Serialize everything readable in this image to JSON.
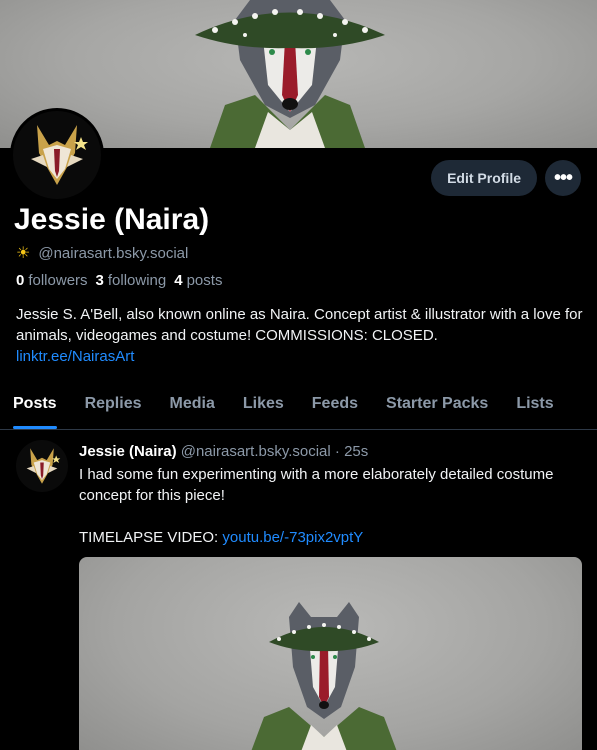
{
  "profile": {
    "display_name": "Jessie (Naira)",
    "handle": "@nairasart.bsky.social",
    "handle_icon": "sun-icon",
    "followers_count": "0",
    "followers_label": "followers",
    "following_count": "3",
    "following_label": "following",
    "posts_count": "4",
    "posts_label": "posts",
    "bio": "Jessie S. A'Bell, also known online as Naira. Concept artist & illustrator with a love for animals, videogames and costume! COMMISSIONS: CLOSED.",
    "bio_link": "linktr.ee/NairasArt"
  },
  "actions": {
    "edit_profile_label": "Edit Profile",
    "more_label": "•••"
  },
  "tabs": [
    {
      "label": "Posts",
      "active": true
    },
    {
      "label": "Replies"
    },
    {
      "label": "Media"
    },
    {
      "label": "Likes"
    },
    {
      "label": "Feeds"
    },
    {
      "label": "Starter Packs"
    },
    {
      "label": "Lists"
    }
  ],
  "post": {
    "author_name": "Jessie (Naira)",
    "author_handle": "@nairasart.bsky.social",
    "separator": "·",
    "timestamp": "25s",
    "text_line1": "I had some fun experimenting with a more elaborately detailed costume concept for this piece!",
    "timelapse_label": "TIMELAPSE VIDEO:",
    "timelapse_link": "youtu.be/-73pix2vptY"
  },
  "colors": {
    "accent": "#208bfe",
    "background": "#000000",
    "muted_text": "#8c99a8",
    "button_bg": "#1e2936"
  }
}
